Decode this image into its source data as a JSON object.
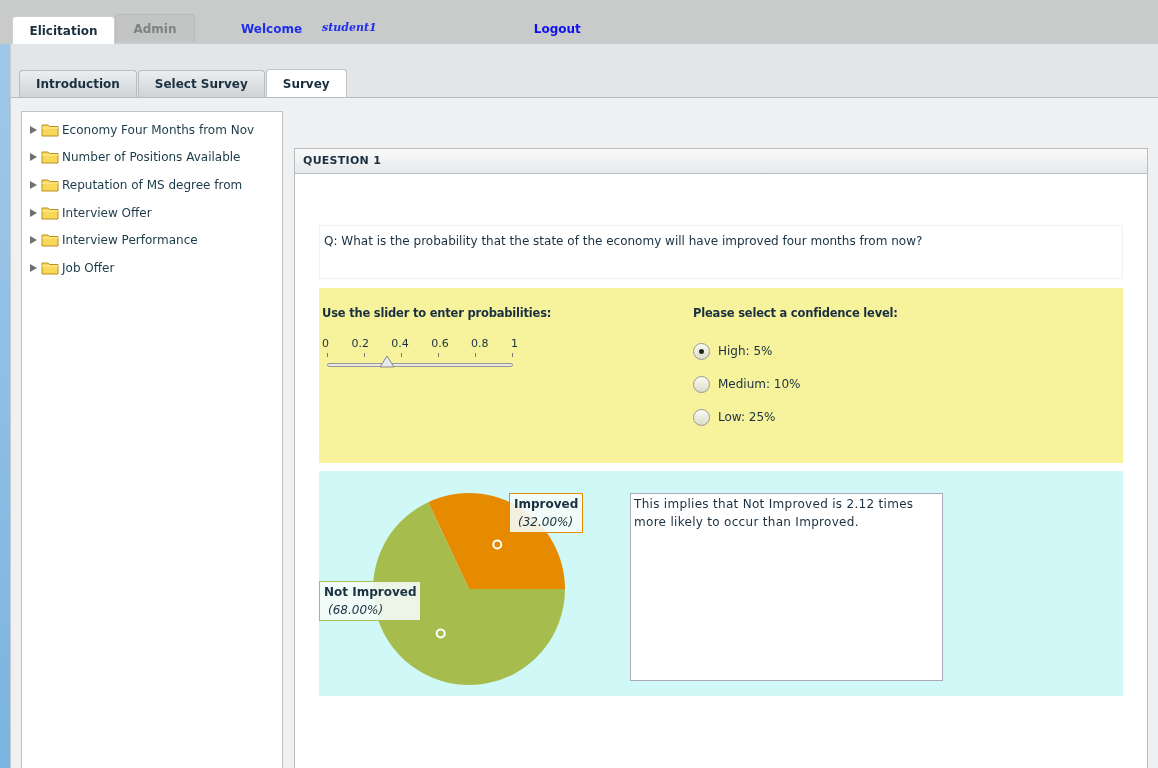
{
  "top_tabs": [
    {
      "label": "Elicitation",
      "selected": true,
      "disabled": false
    },
    {
      "label": "Admin",
      "selected": false,
      "disabled": true
    }
  ],
  "welcome": {
    "label": "Welcome",
    "user": "student1"
  },
  "logout": "Logout",
  "sub_tabs": [
    {
      "label": "Introduction",
      "selected": false
    },
    {
      "label": "Select Survey",
      "selected": false
    },
    {
      "label": "Survey",
      "selected": true
    }
  ],
  "tree": [
    {
      "label": "Economy Four Months from Nov",
      "expanded": false
    },
    {
      "label": "Number of Positions Available",
      "expanded": false
    },
    {
      "label": "Reputation of MS degree from",
      "expanded": false
    },
    {
      "label": "Interview Offer",
      "expanded": false
    },
    {
      "label": "Interview Performance",
      "expanded": false
    },
    {
      "label": "Job Offer",
      "expanded": false
    }
  ],
  "question": {
    "title": "QUESTION 1",
    "text": "Q: What is the probability that the state of the economy will have improved four months from now?"
  },
  "slider": {
    "label": "Use the slider to enter probabilities:",
    "ticks": [
      "0",
      "0.2",
      "0.4",
      "0.6",
      "0.8",
      "1"
    ],
    "level": 0.32
  },
  "confidence": {
    "label": "Please select a confidence level:",
    "options": [
      {
        "label": "High: 5%",
        "selected": true
      },
      {
        "label": "Medium: 10%",
        "selected": false
      },
      {
        "label": "Low: 25%",
        "selected": false
      }
    ]
  },
  "chart_data": {
    "type": "pie",
    "categories": [
      "Improved",
      "Not Improved"
    ],
    "values": [
      32,
      68
    ],
    "colors": [
      "#e68a00",
      "#a6bd4e"
    ],
    "data_labels": true,
    "value_labels": [
      "(32.00%)",
      "(68.00%)"
    ]
  },
  "explanation": "This implies that Not Improved is 2.12 times more likely to occur than Improved."
}
